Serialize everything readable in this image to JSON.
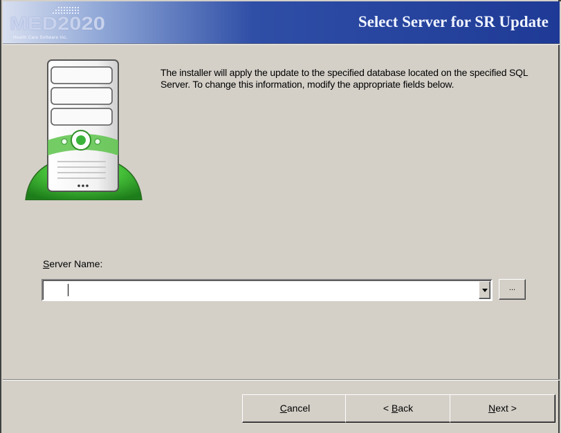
{
  "header": {
    "logo_text": "MED2020",
    "logo_tagline": "Health Care Software Inc.",
    "title": "Select Server for SR Update"
  },
  "description": "The installer will apply the update to the specified database located on the specified SQL Server.  To change this information, modify the appropriate fields below.",
  "server_field": {
    "label_accel": "S",
    "label_rest": "erver Name:",
    "value": ""
  },
  "browse_button": {
    "label": "..."
  },
  "buttons": {
    "cancel": {
      "accel": "C",
      "rest": "ancel"
    },
    "back": {
      "prefix": "< ",
      "accel": "B",
      "rest": "ack"
    },
    "next": {
      "accel": "N",
      "rest": "ext >"
    }
  },
  "colors": {
    "dialog_bg": "#d4d0c8",
    "banner_blue": "#1e3a96",
    "server_green": "#3cb43c"
  },
  "icons": [
    "server-computer-icon",
    "dropdown-arrow-icon"
  ]
}
